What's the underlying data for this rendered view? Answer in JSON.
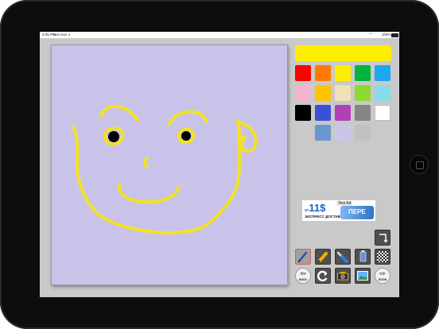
{
  "status_bar": {
    "time": "5:35 PM",
    "date": "Sun Nov 4",
    "battery": "100%"
  },
  "selected_color": "#ffee00",
  "palette": [
    [
      "#ff0000",
      "#ff7a00",
      "#ffee00",
      "#00b33c",
      "#1ba7f2"
    ],
    [
      "#f5b3cf",
      "#ffc400",
      "#f2e0b6",
      "#8fd930",
      "#87dce8"
    ],
    [
      "#000000",
      "#3d4fd6",
      "#b040b8",
      "#858585",
      "#ffffff"
    ],
    [
      "#6a97cf",
      "#ccc5e9",
      "#c0c0c0"
    ]
  ],
  "drawing": {
    "background": "#cac3e9",
    "stroke": "#f2e224"
  },
  "ad": {
    "prefix": "от",
    "price": "11$",
    "sub": "ЭКСПРЕСС ДОСТАВКА",
    "tag": "Test Ad",
    "badge": "ПЕРЕ"
  },
  "tools": [
    {
      "name": "pen",
      "icon": "pen-icon"
    },
    {
      "name": "marker",
      "icon": "marker-icon"
    },
    {
      "name": "brush",
      "icon": "brush-icon"
    },
    {
      "name": "tube",
      "icon": "paint-tube-icon"
    },
    {
      "name": "pattern",
      "icon": "checkerboard-icon"
    }
  ],
  "actions": {
    "back": "BACK",
    "soon": "SOON"
  }
}
